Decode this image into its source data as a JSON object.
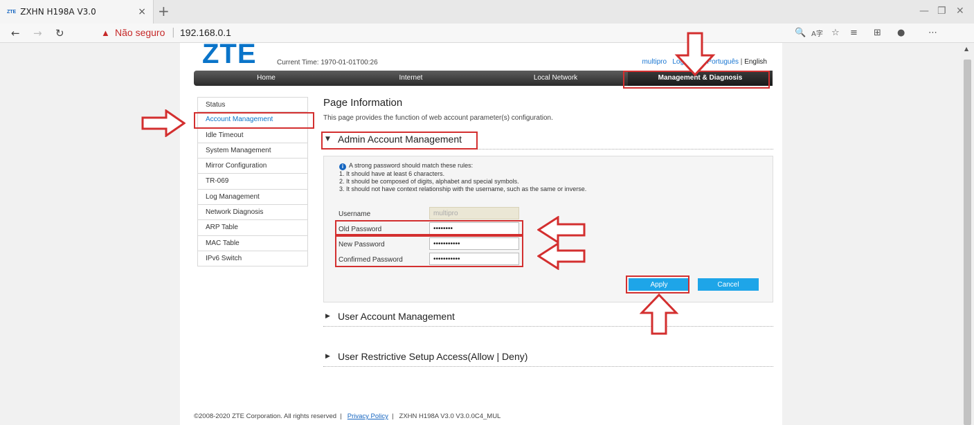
{
  "browser": {
    "tab_title": "ZXHN H198A V3.0",
    "favicon_text": "ZTE",
    "close_glyph": "×",
    "newtab_glyph": "+",
    "security_label": "Não seguro",
    "url": "192.168.0.1"
  },
  "header": {
    "logo": "ZTE",
    "current_time": "Current Time: 1970-01-01T00:26",
    "user": "multipro",
    "logout": "Logout",
    "lang_pt": "Português",
    "lang_sep": "|",
    "lang_en": "English"
  },
  "nav": {
    "items": [
      "Home",
      "Internet",
      "Local Network",
      "Management & Diagnosis"
    ],
    "active": "Management & Diagnosis"
  },
  "sidebar": {
    "items": [
      "Status",
      "Account Management",
      "Idle Timeout",
      "System Management",
      "Mirror Configuration",
      "TR-069",
      "Log Management",
      "Network Diagnosis",
      "ARP Table",
      "MAC Table",
      "IPv6 Switch"
    ],
    "active": "Account Management"
  },
  "content": {
    "page_title": "Page Information",
    "page_desc": "This page provides the function of web account parameter(s) configuration.",
    "admin_section": "Admin Account Management",
    "rules": {
      "intro": "A strong password should match these rules:",
      "r1": "1. It should have at least 6 characters.",
      "r2": "2. It should be composed of digits, alphabet and special symbols.",
      "r3": "3. It should not have context relationship with the username, such as the same or inverse."
    },
    "fields": {
      "username_label": "Username",
      "username_value": "multipro",
      "old_label": "Old Password",
      "old_value": "••••••••",
      "new_label": "New Password",
      "new_value": "•••••••••••",
      "confirm_label": "Confirmed Password",
      "confirm_value": "•••••••••••"
    },
    "apply": "Apply",
    "cancel": "Cancel",
    "user_section": "User Account Management",
    "restrict_section": "User Restrictive Setup Access(Allow | Deny)"
  },
  "footer": {
    "copyright": "©2008-2020 ZTE Corporation. All rights reserved",
    "sep1": "|",
    "privacy": "Privacy Policy",
    "sep2": "|",
    "model": "ZXHN H198A V3.0 V3.0.0C4_MUL"
  },
  "colors": {
    "brand": "#0a74c9",
    "annotation": "#d32f2f",
    "button": "#1ea5e8"
  }
}
